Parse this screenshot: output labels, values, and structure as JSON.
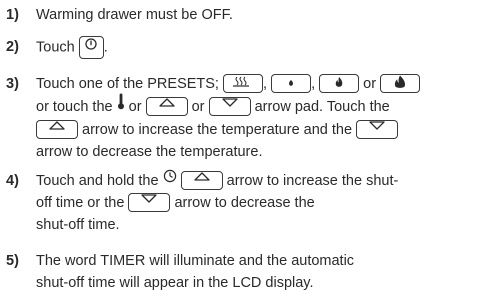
{
  "steps": [
    {
      "number": "1)",
      "lines": [
        "Warming drawer must be OFF."
      ]
    },
    {
      "number": "2)",
      "before": "Touch",
      "after": "."
    },
    {
      "number": "3)",
      "a": "Touch one of the PRESETS;",
      "b": ",",
      "c": ",",
      "d": "or",
      "e": "or touch the",
      "f": "or",
      "g": "arrow pad. Touch the",
      "h": "arrow to increase the temperature and the",
      "i": "arrow to decrease the temperature."
    },
    {
      "number": "4)",
      "a": "Touch and hold the",
      "b": "arrow to increase the shut-",
      "c": "off time or the",
      "d": "arrow to decrease the",
      "e": "shut-off time."
    },
    {
      "number": "5)",
      "lines": [
        "The word TIMER will illuminate and the automatic",
        "shut-off time will appear in the LCD display."
      ]
    }
  ],
  "icons": {
    "power": "power-icon",
    "preset_1": "bread-proof-icon",
    "preset_2": "low-flame-icon",
    "preset_3": "medium-flame-icon",
    "preset_4": "high-flame-icon",
    "thermometer": "thermometer-icon",
    "timer": "clock-icon",
    "up": "up-arrow-icon",
    "down": "down-arrow-icon"
  }
}
